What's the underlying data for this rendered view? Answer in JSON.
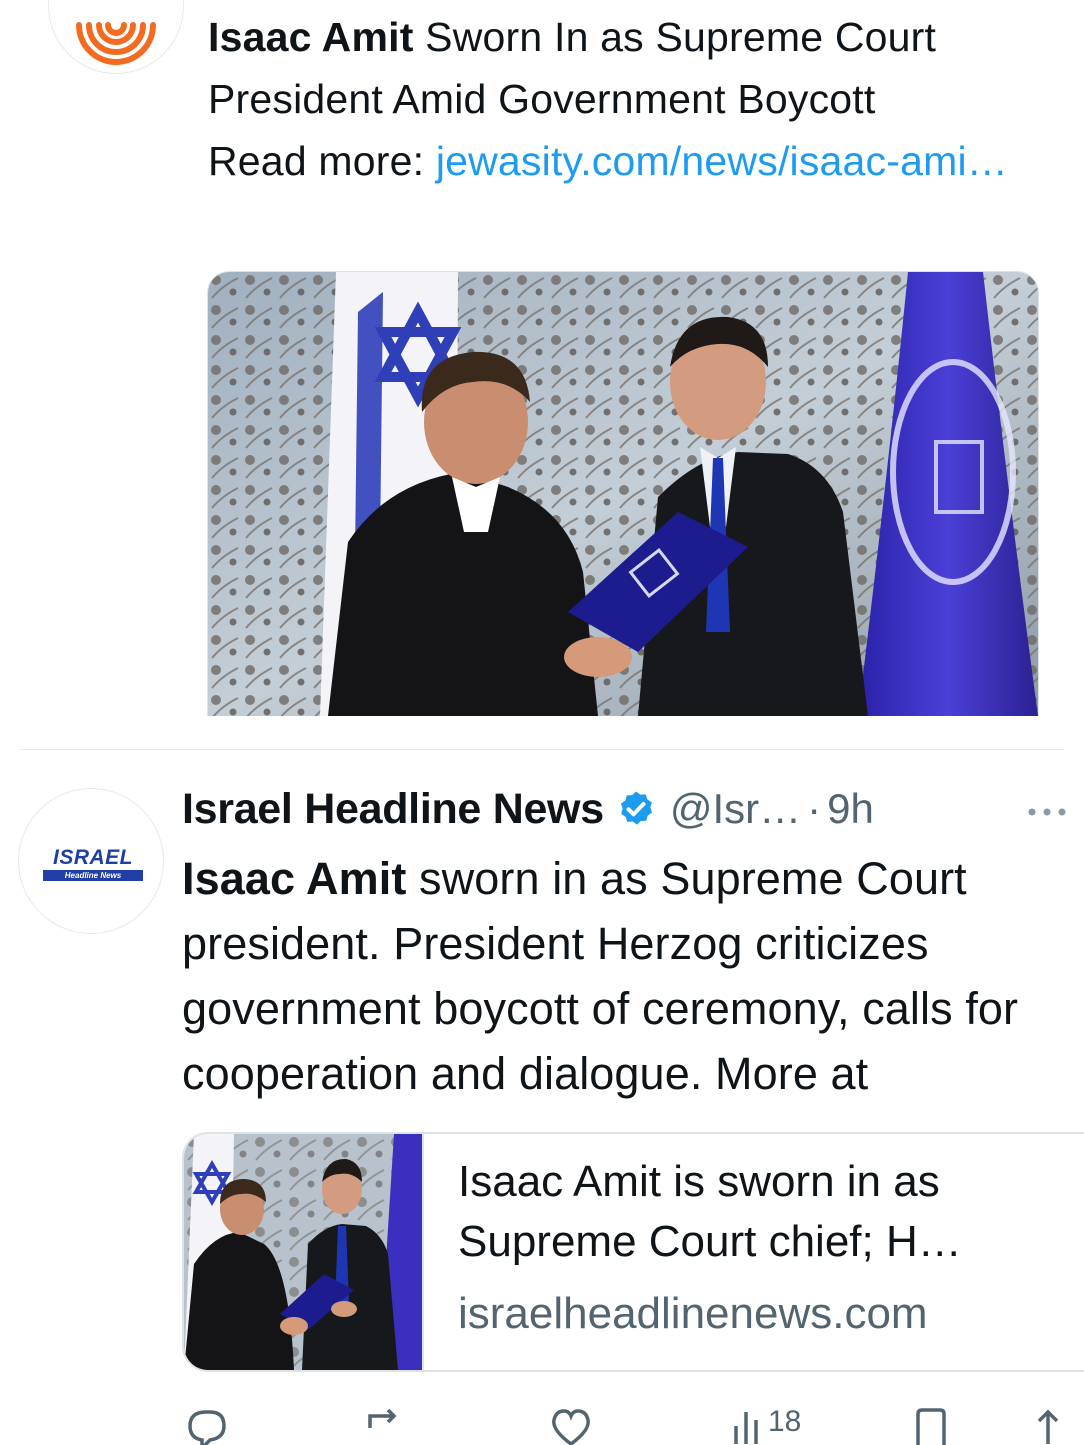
{
  "tweet1": {
    "headline_bold": "Isaac Amit",
    "headline_rest": " Sworn In as Supreme Court President Amid Government Boycott",
    "read_more_label": "Read more: ",
    "link_text": "jewasity.com/news/isaac-ami…",
    "media_alt": "Isaac Amit and President Herzog at swearing-in ceremony"
  },
  "tweet2": {
    "avatar_logo_top": "ISRAEL",
    "avatar_logo_bottom": "Headline News",
    "author_name": "Israel Headline News",
    "handle": "@Isr…",
    "dot": "·",
    "timestamp": "9h",
    "text_bold": "Isaac Amit",
    "text_rest": " sworn in as Supreme Court president. President Herzog criticizes government boycott of ceremony, calls for cooperation and dialogue. More at",
    "card": {
      "title": "Isaac Amit is sworn in as Supreme Court chief; H…",
      "domain": "israelheadlinenews.com"
    },
    "actions": {
      "views": "18"
    }
  },
  "colors": {
    "link": "#1d9bf0",
    "verified": "#1d9bf0",
    "secondary_text": "#536471",
    "jewasity_orange": "#f26b21",
    "ihn_blue": "#1f3fa6"
  },
  "icons": [
    "jewasity-logo-icon",
    "verified-badge-icon",
    "more-icon",
    "reply-icon",
    "retweet-icon",
    "like-icon",
    "views-icon",
    "bookmark-icon",
    "share-icon"
  ]
}
